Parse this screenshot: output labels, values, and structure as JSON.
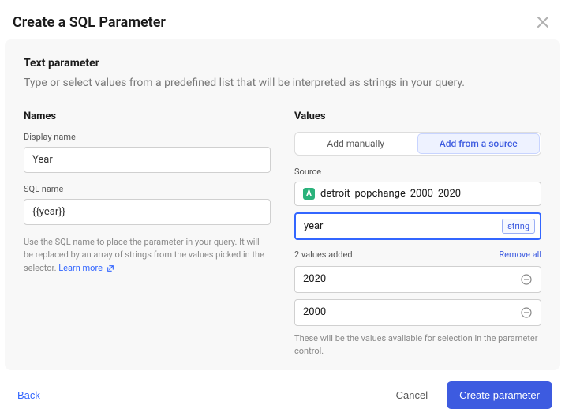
{
  "header": {
    "title": "Create a SQL Parameter"
  },
  "panel": {
    "title": "Text parameter",
    "description": "Type or select values from a predefined list that will be interpreted as strings in your query."
  },
  "names": {
    "section_label": "Names",
    "display_name_label": "Display name",
    "display_name_value": "Year",
    "sql_name_label": "SQL name",
    "sql_name_value": "{{year}}",
    "help_text": "Use the SQL name to place the parameter in your query. It will be replaced by an array of strings from the values picked in the selector. ",
    "learn_more": "Learn more"
  },
  "values": {
    "section_label": "Values",
    "toggle": {
      "manual": "Add manually",
      "source": "Add from a source",
      "active": "source"
    },
    "source_label": "Source",
    "source_value": "detroit_popchange_2000_2020",
    "source_badge": "A",
    "column_value": "year",
    "column_type": "string",
    "count_text": "2 values added",
    "remove_all": "Remove all",
    "items": [
      "2020",
      "2000"
    ],
    "help_text": "These will be the values available for selection in the parameter control."
  },
  "footer": {
    "back": "Back",
    "cancel": "Cancel",
    "create": "Create parameter"
  }
}
